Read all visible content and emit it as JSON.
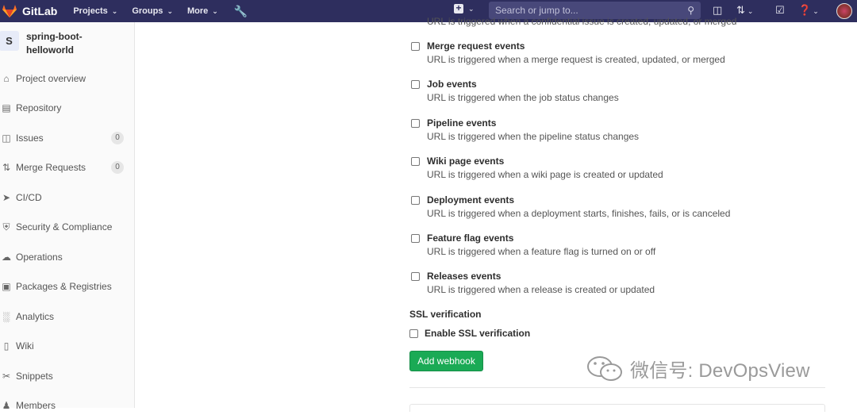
{
  "navbar": {
    "brand": "GitLab",
    "menus": [
      {
        "label": "Projects"
      },
      {
        "label": "Groups"
      },
      {
        "label": "More"
      }
    ],
    "search_placeholder": "Search or jump to...",
    "accent_color": "#2e2e5e"
  },
  "sidebar": {
    "project_initial": "S",
    "project_name": "spring-boot-helloworld",
    "items": [
      {
        "label": "Project overview",
        "icon": "home-icon"
      },
      {
        "label": "Repository",
        "icon": "book-icon"
      },
      {
        "label": "Issues",
        "icon": "issues-icon",
        "count": "0"
      },
      {
        "label": "Merge Requests",
        "icon": "git-merge-icon",
        "count": "0"
      },
      {
        "label": "CI/CD",
        "icon": "rocket-icon"
      },
      {
        "label": "Security & Compliance",
        "icon": "shield-icon"
      },
      {
        "label": "Operations",
        "icon": "cloud-gear-icon"
      },
      {
        "label": "Packages & Registries",
        "icon": "package-icon"
      },
      {
        "label": "Analytics",
        "icon": "chart-icon"
      },
      {
        "label": "Wiki",
        "icon": "wiki-icon"
      },
      {
        "label": "Snippets",
        "icon": "scissors-icon"
      },
      {
        "label": "Members",
        "icon": "users-icon"
      }
    ]
  },
  "main": {
    "cut_off_description": "URL is triggered when a confidential issue is created, updated, or merged",
    "events": [
      {
        "title": "Merge request events",
        "description": "URL is triggered when a merge request is created, updated, or merged"
      },
      {
        "title": "Job events",
        "description": "URL is triggered when the job status changes"
      },
      {
        "title": "Pipeline events",
        "description": "URL is triggered when the pipeline status changes"
      },
      {
        "title": "Wiki page events",
        "description": "URL is triggered when a wiki page is created or updated"
      },
      {
        "title": "Deployment events",
        "description": "URL is triggered when a deployment starts, finishes, fails, or is canceled"
      },
      {
        "title": "Feature flag events",
        "description": "URL is triggered when a feature flag is turned on or off"
      },
      {
        "title": "Releases events",
        "description": "URL is triggered when a release is created or updated"
      }
    ],
    "ssl_heading": "SSL verification",
    "ssl_checkbox_label": "Enable SSL verification",
    "add_button_label": "Add webhook",
    "button_color": "#1aaa55"
  },
  "watermark": {
    "text": "微信号: DevOpsView"
  }
}
